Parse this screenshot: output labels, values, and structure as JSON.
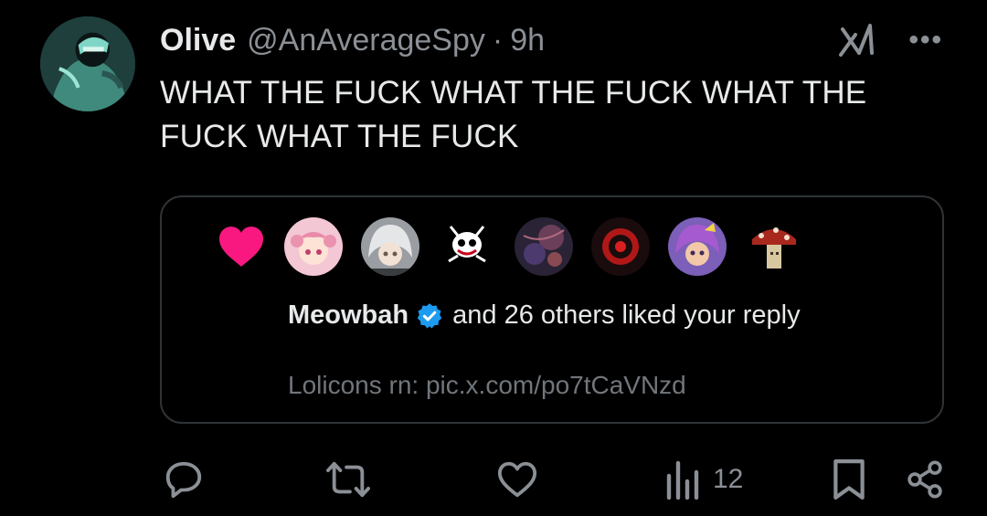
{
  "tweet": {
    "display_name": "Olive",
    "handle": "@AnAverageSpy",
    "separator": "·",
    "time": "9h",
    "text": "WHAT THE FUCK WHAT THE FUCK WHAT THE FUCK WHAT THE FUCK",
    "top_icons": [
      "grok-icon",
      "more-icon"
    ],
    "more_label": "•••"
  },
  "card": {
    "icon": "heart-icon",
    "liker_name": "Meowbah",
    "liker_verified": true,
    "like_rest": "and 26 others liked your reply",
    "quoted_text": "Lolicons rn: pic.x.com/po7tCaVNzd"
  },
  "actions": {
    "items": [
      "reply-icon",
      "retweet-icon",
      "like-icon",
      "views-icon",
      "bookmark-icon",
      "share-icon"
    ],
    "view_count": "12"
  },
  "colors": {
    "background": "#000000",
    "text": "#e7e9ea",
    "muted": "#8b9096",
    "heart": "#f91880",
    "verified": "#1d9bf0",
    "card_border": "#2f3336"
  }
}
